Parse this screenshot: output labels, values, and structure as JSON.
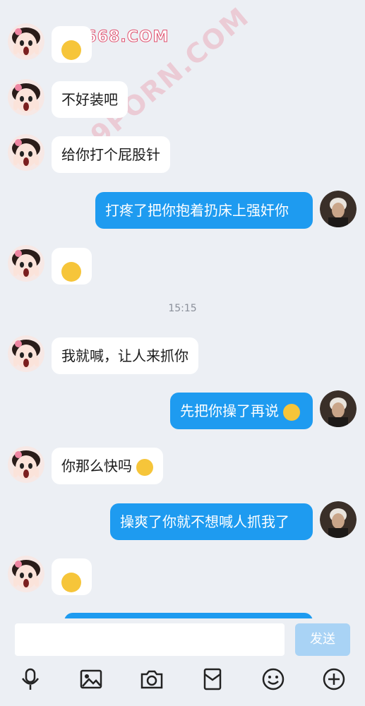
{
  "watermark": {
    "top": "9P668.COM",
    "diagonal": "9PORN.COM"
  },
  "messages": [
    {
      "side": "in",
      "text": "",
      "emoji": "thinking-face"
    },
    {
      "side": "in",
      "text": "不好装吧"
    },
    {
      "side": "in",
      "text": "给你打个屁股针"
    },
    {
      "side": "out",
      "text": "打疼了把你抱着扔床上强奸你"
    },
    {
      "side": "in",
      "text": "",
      "emoji": "laughing-crying-face"
    },
    {
      "side": "in",
      "text": "我就喊，让人来抓你"
    },
    {
      "side": "out",
      "text": "先把你操了再说",
      "emoji": "surprised-face"
    },
    {
      "side": "in",
      "text": "你那么快吗",
      "emoji": "thinking-face"
    },
    {
      "side": "out",
      "text": "操爽了你就不想喊人抓我了"
    },
    {
      "side": "in",
      "text": "",
      "emoji": "thinking-face"
    }
  ],
  "timestamp": "15:15",
  "composer": {
    "placeholder": "",
    "send_label": "发送"
  },
  "toolbar": [
    "microphone-icon",
    "image-icon",
    "camera-icon",
    "red-packet-icon",
    "emoji-icon",
    "plus-icon"
  ],
  "colors": {
    "background": "#eceff4",
    "outgoing_bubble": "#1e9bf0",
    "incoming_bubble": "#ffffff",
    "send_button_disabled": "#a9d3f5"
  }
}
